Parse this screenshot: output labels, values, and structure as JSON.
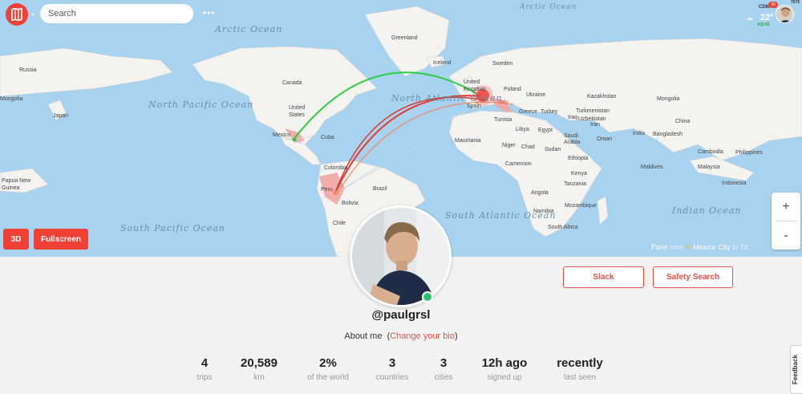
{
  "topbar": {
    "search_placeholder": "Search",
    "menu_dots": "•••",
    "caret": "⌄",
    "weather": {
      "city": "CDM",
      "temp": "22°",
      "aqi": "AQI 62",
      "icon": "cloud-icon"
    },
    "notifications": "30",
    "rate": "767€"
  },
  "map": {
    "countries": [
      "Russia",
      "Mongolia",
      "Japan",
      "Canada",
      "Greenland",
      "Iceland",
      "Sweden",
      "United Kingdom",
      "Poland",
      "Ukraine",
      "Kazakhstan",
      "Mongolia",
      "Turkmenistan",
      "Uzbekistan",
      "China",
      "Turkey",
      "Greece",
      "Spain",
      "Italy",
      "Tunisia",
      "Libya",
      "Egypt",
      "Iraq",
      "Iran",
      "Saudi Arabia",
      "Oman",
      "India",
      "Bangladesh",
      "Cambodia",
      "Philippines",
      "Malaysia",
      "United States",
      "Mexico",
      "Cuba",
      "Colombia",
      "Peru",
      "Brazil",
      "Bolivia",
      "Chile",
      "Mauritania",
      "Niger",
      "Chad",
      "Sudan",
      "Ethiopia",
      "Kenya",
      "Cameroon",
      "Tanzania",
      "Angola",
      "Namibia",
      "Mozambique",
      "South Africa",
      "Maldives",
      "Papua New Guinea",
      "Indonesia"
    ],
    "oceans": {
      "arctic": "Arctic Ocean",
      "arctic_right": "Arctic Ocean",
      "north_pacific": "North Pacific Ocean",
      "north_atlantic": "North Atlantic Ocean",
      "south_pacific": "South Pacific Ocean",
      "south_atlantic": "South Atlantic Ocean",
      "indian": "Indian Ocean"
    },
    "buttons": {
      "three_d": "3D",
      "fullscreen": "Fullscreen"
    },
    "zoom": {
      "in": "+",
      "out": "-"
    },
    "route_caption": {
      "from": "Paris",
      "now": "now",
      "arrow": "✈",
      "to": "Mexico City",
      "in": "in 7d"
    },
    "colors": {
      "route_green": "#2ecc40",
      "route_red": "#e03a2f",
      "water": "#a7d3f0",
      "land": "#f1f1ef"
    }
  },
  "profile": {
    "username": "@paulgrsl",
    "about_label": "About me",
    "bio_link": "Change your bio",
    "status": "online",
    "buttons": {
      "slack": "Slack",
      "safety_search": "Safety Search"
    }
  },
  "stats": [
    {
      "value": "4",
      "label": "trips"
    },
    {
      "value": "20,589",
      "label": "km"
    },
    {
      "value": "2%",
      "label": "of the world"
    },
    {
      "value": "3",
      "label": "countries"
    },
    {
      "value": "3",
      "label": "cities"
    },
    {
      "value": "12h ago",
      "label": "signed up"
    },
    {
      "value": "recently",
      "label": "last seen"
    }
  ],
  "feedback": "Feedback",
  "accent": "#ef4136"
}
